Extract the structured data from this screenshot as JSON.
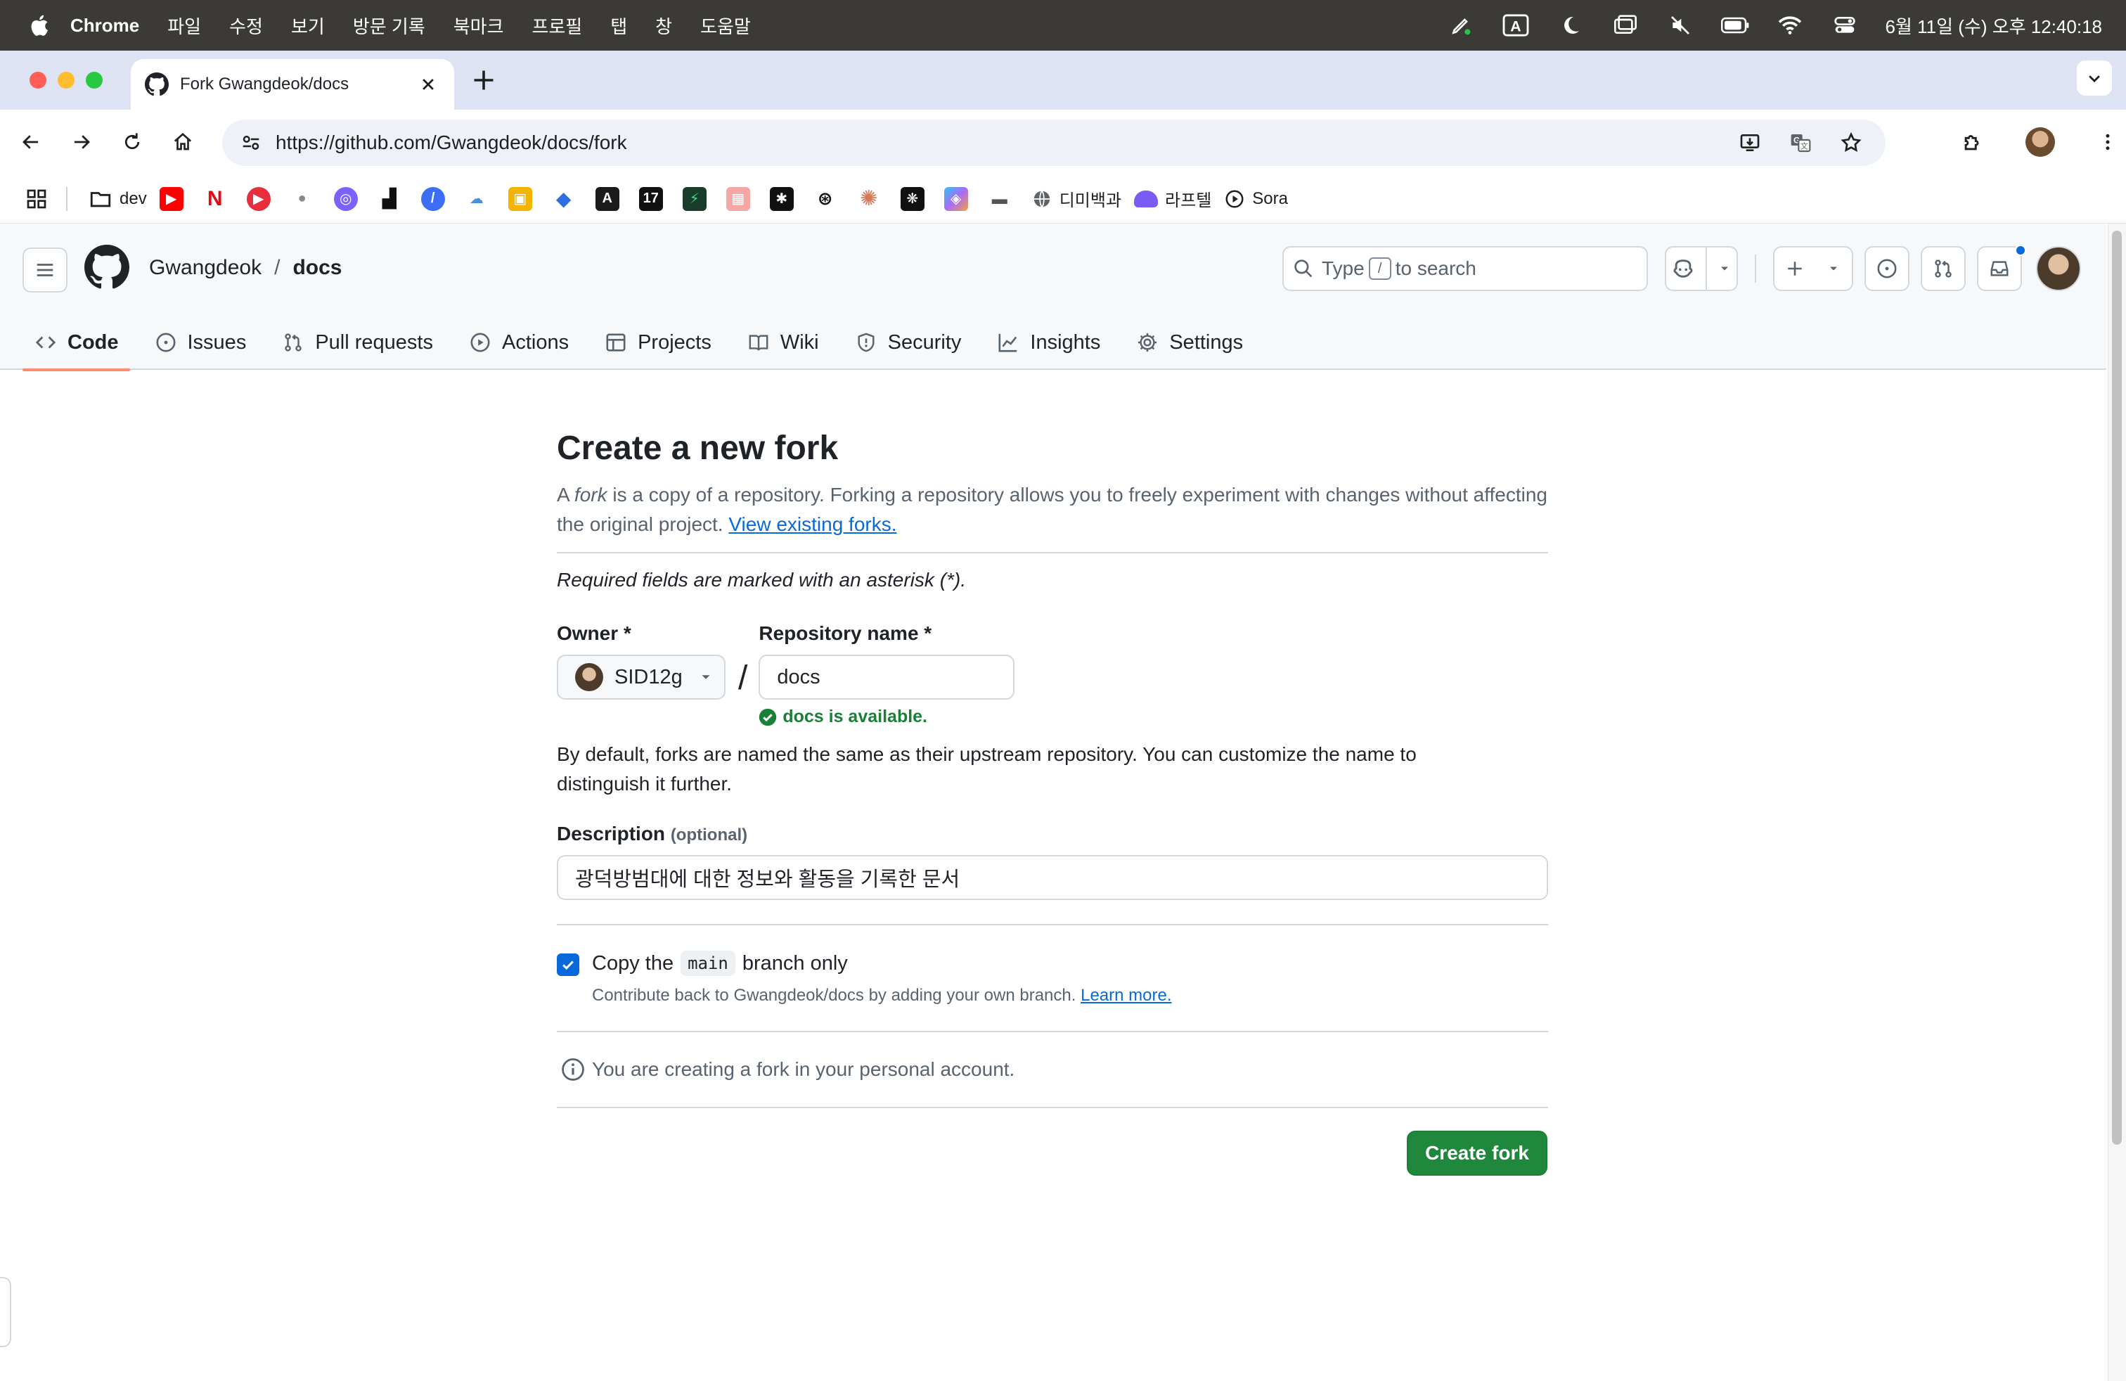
{
  "menubar": {
    "app": "Chrome",
    "items": [
      "파일",
      "수정",
      "보기",
      "방문 기록",
      "북마크",
      "프로필",
      "탭",
      "창",
      "도움말"
    ],
    "clock": "6월 11일 (수) 오후 12:40:18"
  },
  "browser": {
    "tab_title": "Fork Gwangdeok/docs",
    "url": "https://github.com/Gwangdeok/docs/fork",
    "bookmarks": {
      "dev": "dev",
      "dimi": "디미백과",
      "laftel": "라프텔",
      "sora": "Sora"
    }
  },
  "github": {
    "owner": "Gwangdeok",
    "separator": "/",
    "repo": "docs",
    "search_prefix": "Type",
    "search_key": "/",
    "search_suffix": "to search",
    "nav": {
      "code": "Code",
      "issues": "Issues",
      "pulls": "Pull requests",
      "actions": "Actions",
      "projects": "Projects",
      "wiki": "Wiki",
      "security": "Security",
      "insights": "Insights",
      "settings": "Settings"
    }
  },
  "form": {
    "title": "Create a new fork",
    "lead_a": "A",
    "lead_fork": "fork",
    "lead_b": "is a copy of a repository. Forking a repository allows you to freely experiment with changes without affecting the original project.",
    "lead_link": "View existing forks.",
    "required_note": "Required fields are marked with an asterisk (*).",
    "owner_label": "Owner *",
    "owner_value": "SID12g",
    "slash": "/",
    "repo_label": "Repository name *",
    "repo_value": "docs",
    "availability": "docs is available.",
    "naming_note": "By default, forks are named the same as their upstream repository. You can customize the name to distinguish it further.",
    "desc_label": "Description",
    "desc_optional": "(optional)",
    "desc_value": "광덕방범대에 대한 정보와 활동을 기록한 문서",
    "copy_pre": "Copy the",
    "copy_branch": "main",
    "copy_post": "branch only",
    "copy_sub": "Contribute back to Gwangdeok/docs by adding your own branch.",
    "copy_learn": "Learn more.",
    "info": "You are creating a fork in your personal account.",
    "submit": "Create fork"
  },
  "colors": {
    "primary_button": "#1f883d",
    "link": "#0969da",
    "success": "#1a7f37",
    "active_tab_underline": "#fd8c73"
  }
}
